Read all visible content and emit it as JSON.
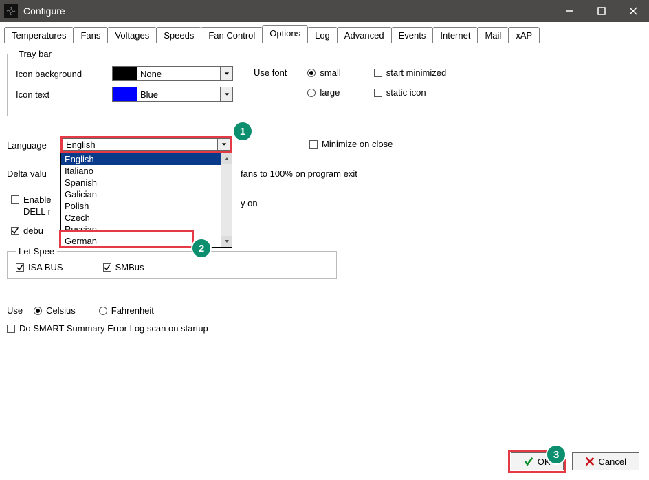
{
  "window": {
    "title": "Configure"
  },
  "tabs": [
    "Temperatures",
    "Fans",
    "Voltages",
    "Speeds",
    "Fan Control",
    "Options",
    "Log",
    "Advanced",
    "Events",
    "Internet",
    "Mail",
    "xAP"
  ],
  "active_tab": "Options",
  "tray": {
    "legend": "Tray bar",
    "icon_bg_label": "Icon background",
    "icon_bg_value": "None",
    "icon_bg_swatch": "#000000",
    "icon_text_label": "Icon text",
    "icon_text_value": "Blue",
    "icon_text_swatch": "#0000ff",
    "use_font_label": "Use font",
    "font_small": "small",
    "font_large": "large",
    "start_min": "start minimized",
    "static_icon": "static icon"
  },
  "language": {
    "label": "Language",
    "value": "English",
    "options": [
      "English",
      "Italiano",
      "Spanish",
      "Galician",
      "Polish",
      "Czech",
      "Russian",
      "German"
    ],
    "highlight": "Russian"
  },
  "minimize_on_close": "Minimize on close",
  "delta_label": "Delta valu",
  "fans100_label": "fans to 100% on program exit",
  "enable_dell_line1": "Enable",
  "enable_dell_line2": "DELL r",
  "y_on": "y on",
  "debug_label": "debu",
  "letspeed": {
    "legend": "Let Spee",
    "isa": "ISA BUS",
    "smbus": "SMBus"
  },
  "use": {
    "label": "Use",
    "celsius": "Celsius",
    "fahrenheit": "Fahrenheit"
  },
  "smart_label": "Do SMART Summary Error Log scan on startup",
  "buttons": {
    "ok": "OK",
    "cancel": "Cancel"
  },
  "steps": {
    "one": "1",
    "two": "2",
    "three": "3"
  }
}
